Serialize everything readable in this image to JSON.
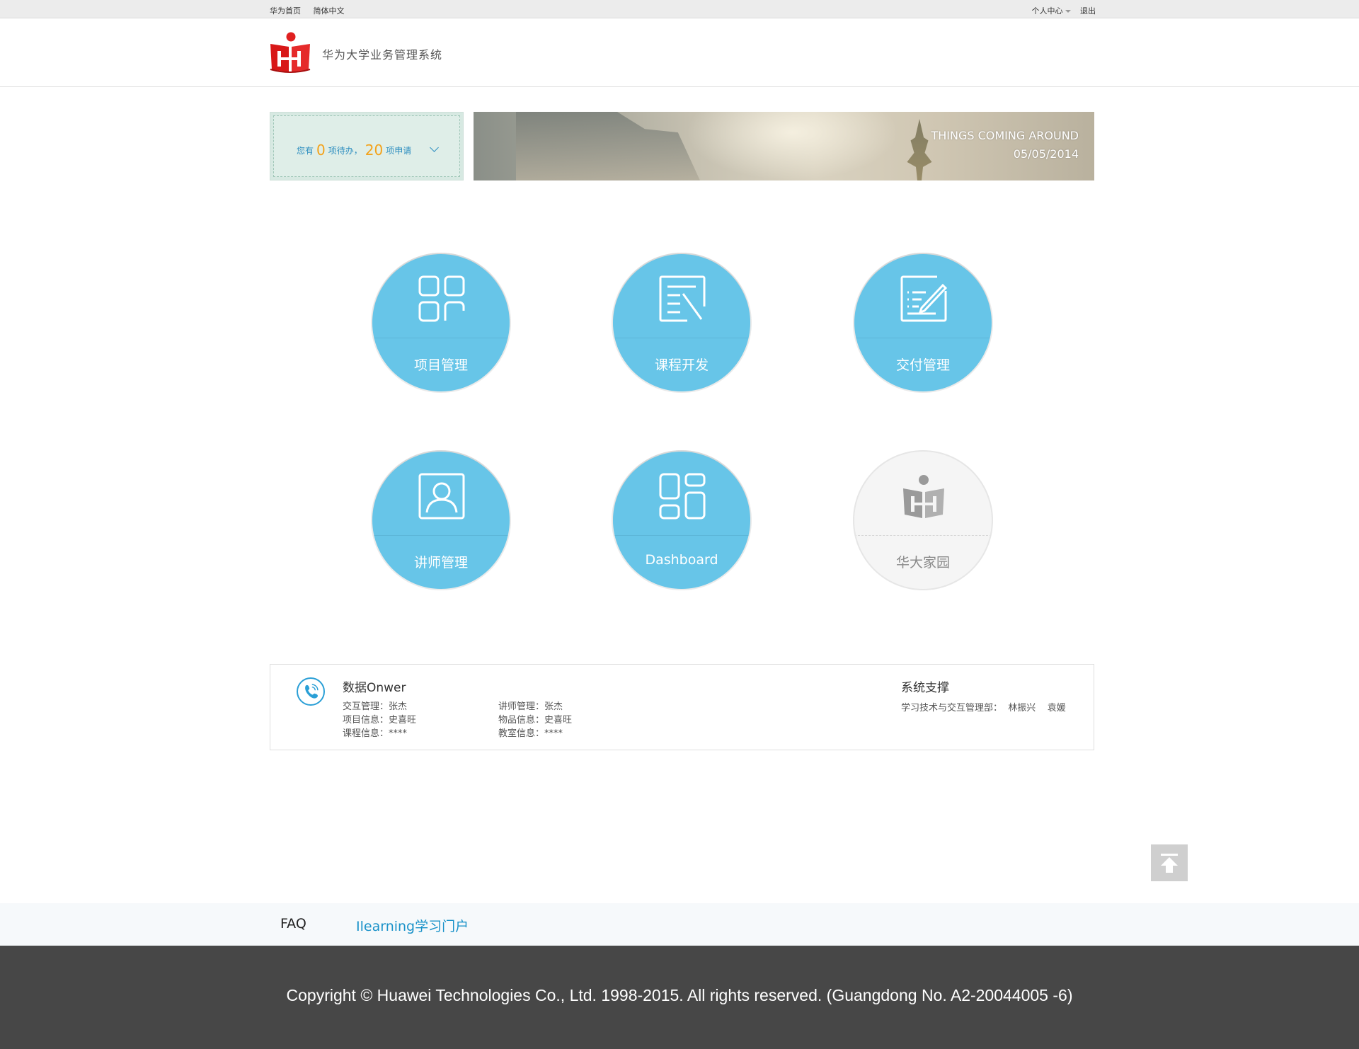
{
  "topbar": {
    "home_link": "华为首页",
    "language": "简体中文",
    "personal_center": "个人中心",
    "logout": "退出"
  },
  "header": {
    "system_title": "华为大学业务管理系统"
  },
  "todo": {
    "prefix": "您有",
    "pending_count": "0",
    "pending_label": "项待办，",
    "request_count": "20",
    "request_label": "项申请"
  },
  "banner": {
    "line1": "THINGS COMING AROUND",
    "line2": "05/05/2014"
  },
  "tiles": [
    {
      "label": "项目管理",
      "icon": "grid-icon"
    },
    {
      "label": "课程开发",
      "icon": "edit-document-icon"
    },
    {
      "label": "交付管理",
      "icon": "checklist-edit-icon"
    },
    {
      "label": "讲师管理",
      "icon": "user-icon"
    },
    {
      "label": "Dashboard",
      "icon": "dashboard-icon"
    },
    {
      "label": "华大家园",
      "icon": "huawei-logo-icon"
    }
  ],
  "info": {
    "owner_title": "数据Onwer",
    "col1": [
      "交互管理：张杰",
      "项目信息：史喜旺",
      "课程信息：****"
    ],
    "col2": [
      "讲师管理：张杰",
      "物品信息：史喜旺",
      "教室信息：****"
    ],
    "support_title": "系统支撑",
    "support_text": "学习技术与交互管理部：  林振兴    袁媛"
  },
  "footer": {
    "faq": "FAQ",
    "portal": "Ilearning学习门户",
    "copyright": "Copyright © Huawei Technologies Co., Ltd. 1998-2015. All rights reserved. (Guangdong No. A2-20044005 -6)"
  },
  "colors": {
    "tile_blue": "#67c5e8",
    "accent_orange": "#f3a21a",
    "link_blue": "#1a92c9",
    "footer_dark": "#474747"
  }
}
